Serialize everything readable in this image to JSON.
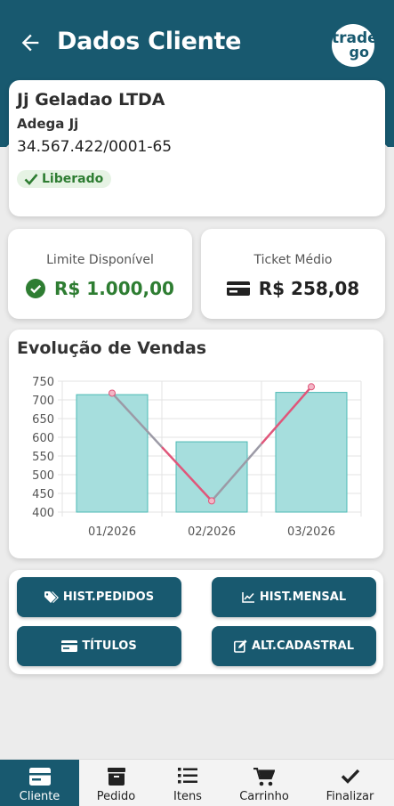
{
  "header": {
    "title": "Dados Cliente",
    "logo_line1": "trade",
    "logo_line2": "go",
    "color": "#18596f"
  },
  "client": {
    "name": "Jj Geladao LTDA",
    "fantasy_name": "Adega Jj",
    "document": "34.567.422/0001-65",
    "status": "Liberado"
  },
  "metrics": {
    "limit_label": "Limite Disponível",
    "limit_value": "R$ 1.000,00",
    "ticket_label": "Ticket Médio",
    "ticket_value": "R$ 258,08"
  },
  "chart": {
    "title": "Evolução de Vendas"
  },
  "chart_data": {
    "type": "bar",
    "categories": [
      "01/2026",
      "02/2026",
      "03/2026"
    ],
    "series": [
      {
        "type": "bar",
        "values": [
          714,
          588,
          720
        ],
        "color": "#a6dedd"
      },
      {
        "type": "line",
        "values": [
          718,
          430,
          735
        ],
        "color": "#e0567a"
      }
    ],
    "ylim": [
      400,
      750
    ],
    "yticks": [
      400,
      450,
      500,
      550,
      600,
      650,
      700,
      750
    ],
    "grid": true
  },
  "actions": {
    "hist_pedidos": "HIST.PEDIDOS",
    "hist_mensal": "HIST.MENSAL",
    "titulos": "TÍTULOS",
    "alt_cadastral": "ALT.CADASTRAL"
  },
  "nav": {
    "cliente": "Cliente",
    "pedido": "Pedido",
    "itens": "Itens",
    "carrinho": "Carrinho",
    "finalizar": "Finalizar"
  }
}
